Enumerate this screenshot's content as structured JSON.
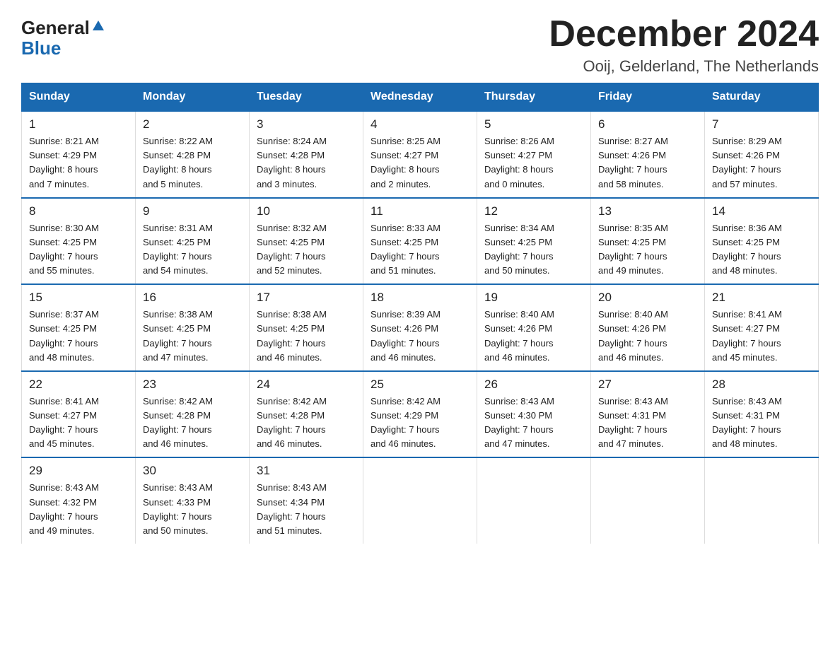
{
  "logo": {
    "general": "General",
    "blue": "Blue",
    "arrow": "▲"
  },
  "title": {
    "month": "December 2024",
    "location": "Ooij, Gelderland, The Netherlands"
  },
  "headers": [
    "Sunday",
    "Monday",
    "Tuesday",
    "Wednesday",
    "Thursday",
    "Friday",
    "Saturday"
  ],
  "weeks": [
    [
      {
        "day": "1",
        "sunrise": "8:21 AM",
        "sunset": "4:29 PM",
        "daylight": "8 hours and 7 minutes."
      },
      {
        "day": "2",
        "sunrise": "8:22 AM",
        "sunset": "4:28 PM",
        "daylight": "8 hours and 5 minutes."
      },
      {
        "day": "3",
        "sunrise": "8:24 AM",
        "sunset": "4:28 PM",
        "daylight": "8 hours and 3 minutes."
      },
      {
        "day": "4",
        "sunrise": "8:25 AM",
        "sunset": "4:27 PM",
        "daylight": "8 hours and 2 minutes."
      },
      {
        "day": "5",
        "sunrise": "8:26 AM",
        "sunset": "4:27 PM",
        "daylight": "8 hours and 0 minutes."
      },
      {
        "day": "6",
        "sunrise": "8:27 AM",
        "sunset": "4:26 PM",
        "daylight": "7 hours and 58 minutes."
      },
      {
        "day": "7",
        "sunrise": "8:29 AM",
        "sunset": "4:26 PM",
        "daylight": "7 hours and 57 minutes."
      }
    ],
    [
      {
        "day": "8",
        "sunrise": "8:30 AM",
        "sunset": "4:25 PM",
        "daylight": "7 hours and 55 minutes."
      },
      {
        "day": "9",
        "sunrise": "8:31 AM",
        "sunset": "4:25 PM",
        "daylight": "7 hours and 54 minutes."
      },
      {
        "day": "10",
        "sunrise": "8:32 AM",
        "sunset": "4:25 PM",
        "daylight": "7 hours and 52 minutes."
      },
      {
        "day": "11",
        "sunrise": "8:33 AM",
        "sunset": "4:25 PM",
        "daylight": "7 hours and 51 minutes."
      },
      {
        "day": "12",
        "sunrise": "8:34 AM",
        "sunset": "4:25 PM",
        "daylight": "7 hours and 50 minutes."
      },
      {
        "day": "13",
        "sunrise": "8:35 AM",
        "sunset": "4:25 PM",
        "daylight": "7 hours and 49 minutes."
      },
      {
        "day": "14",
        "sunrise": "8:36 AM",
        "sunset": "4:25 PM",
        "daylight": "7 hours and 48 minutes."
      }
    ],
    [
      {
        "day": "15",
        "sunrise": "8:37 AM",
        "sunset": "4:25 PM",
        "daylight": "7 hours and 48 minutes."
      },
      {
        "day": "16",
        "sunrise": "8:38 AM",
        "sunset": "4:25 PM",
        "daylight": "7 hours and 47 minutes."
      },
      {
        "day": "17",
        "sunrise": "8:38 AM",
        "sunset": "4:25 PM",
        "daylight": "7 hours and 46 minutes."
      },
      {
        "day": "18",
        "sunrise": "8:39 AM",
        "sunset": "4:26 PM",
        "daylight": "7 hours and 46 minutes."
      },
      {
        "day": "19",
        "sunrise": "8:40 AM",
        "sunset": "4:26 PM",
        "daylight": "7 hours and 46 minutes."
      },
      {
        "day": "20",
        "sunrise": "8:40 AM",
        "sunset": "4:26 PM",
        "daylight": "7 hours and 46 minutes."
      },
      {
        "day": "21",
        "sunrise": "8:41 AM",
        "sunset": "4:27 PM",
        "daylight": "7 hours and 45 minutes."
      }
    ],
    [
      {
        "day": "22",
        "sunrise": "8:41 AM",
        "sunset": "4:27 PM",
        "daylight": "7 hours and 45 minutes."
      },
      {
        "day": "23",
        "sunrise": "8:42 AM",
        "sunset": "4:28 PM",
        "daylight": "7 hours and 46 minutes."
      },
      {
        "day": "24",
        "sunrise": "8:42 AM",
        "sunset": "4:28 PM",
        "daylight": "7 hours and 46 minutes."
      },
      {
        "day": "25",
        "sunrise": "8:42 AM",
        "sunset": "4:29 PM",
        "daylight": "7 hours and 46 minutes."
      },
      {
        "day": "26",
        "sunrise": "8:43 AM",
        "sunset": "4:30 PM",
        "daylight": "7 hours and 47 minutes."
      },
      {
        "day": "27",
        "sunrise": "8:43 AM",
        "sunset": "4:31 PM",
        "daylight": "7 hours and 47 minutes."
      },
      {
        "day": "28",
        "sunrise": "8:43 AM",
        "sunset": "4:31 PM",
        "daylight": "7 hours and 48 minutes."
      }
    ],
    [
      {
        "day": "29",
        "sunrise": "8:43 AM",
        "sunset": "4:32 PM",
        "daylight": "7 hours and 49 minutes."
      },
      {
        "day": "30",
        "sunrise": "8:43 AM",
        "sunset": "4:33 PM",
        "daylight": "7 hours and 50 minutes."
      },
      {
        "day": "31",
        "sunrise": "8:43 AM",
        "sunset": "4:34 PM",
        "daylight": "7 hours and 51 minutes."
      },
      null,
      null,
      null,
      null
    ]
  ]
}
